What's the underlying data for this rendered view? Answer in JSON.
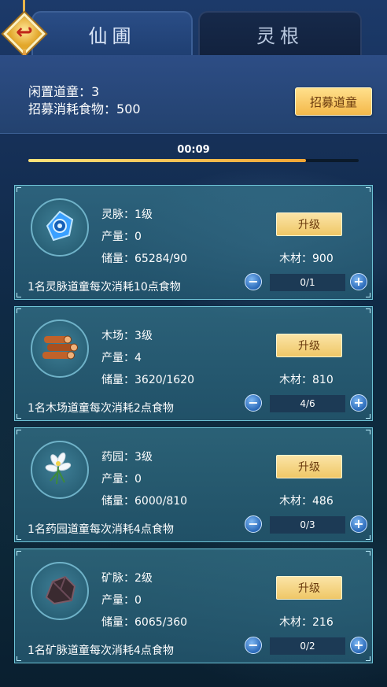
{
  "tabs": [
    {
      "label": "仙圃",
      "active": true
    },
    {
      "label": "灵根",
      "active": false
    }
  ],
  "header": {
    "idle_label": "闲置道童：",
    "idle_value": "3",
    "recruit_cost_label": "招募消耗食物：",
    "recruit_cost_value": "500",
    "recruit_button": "招募道童"
  },
  "timer": {
    "text": "00:09",
    "progress_fraction": 0.84
  },
  "labels": {
    "output": "产量：",
    "storage": "储量：",
    "upgrade": "升级",
    "wood": "木材："
  },
  "buildings": [
    {
      "name_level": "灵脉：1级",
      "output": "0",
      "storage": "65284/90",
      "wood": "900",
      "consume": "1名灵脉道童每次消耗10点食物",
      "workers": "0/1",
      "icon": "spirit-gem-icon"
    },
    {
      "name_level": "木场：3级",
      "output": "4",
      "storage": "3620/1620",
      "wood": "810",
      "consume": "1名木场道童每次消耗2点食物",
      "workers": "4/6",
      "icon": "wood-logs-icon"
    },
    {
      "name_level": "药园：3级",
      "output": "0",
      "storage": "6000/810",
      "wood": "486",
      "consume": "1名药园道童每次消耗4点食物",
      "workers": "0/3",
      "icon": "herb-flower-icon"
    },
    {
      "name_level": "矿脉：2级",
      "output": "0",
      "storage": "6065/360",
      "wood": "216",
      "consume": "1名矿脉道童每次消耗4点食物",
      "workers": "0/2",
      "icon": "ore-rock-icon"
    }
  ],
  "colors": {
    "accent_gold": "#f4b84a",
    "progress": "#f2a635",
    "stepper_blue": "#2a69b8"
  }
}
